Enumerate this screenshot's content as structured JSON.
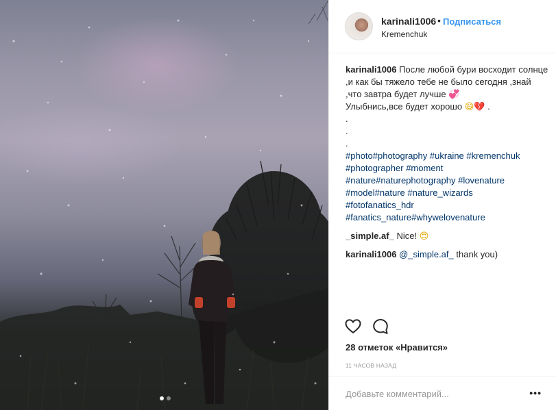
{
  "post": {
    "username": "karinali1006",
    "separator": "•",
    "follow_label": "Подписаться",
    "location": "Kremenchuk",
    "caption_user": "karinali1006",
    "caption_text": "После любой бури восходит солнце ,и как бы тяжело тебе не было сегодня ,знай ,что завтра будет лучше",
    "caption_emoji_1": "💞",
    "caption_line2": "Улыбнись,все будет хорошо",
    "caption_emoji_2": "😄💔",
    "caption_end": " .",
    "dots": [
      ".",
      ".",
      "."
    ],
    "hashtags": [
      "#photo",
      "#photography",
      "#ukraine",
      "#kremenchuk",
      "#photographer",
      "#moment",
      "#nature",
      "#naturephotography",
      "#lovenature",
      "#model",
      "#nature",
      "#nature_wizards",
      "#fotofanatics_hdr",
      "#fanatics_nature",
      "#whywelovenature"
    ],
    "comments": [
      {
        "user": "_simple.af_",
        "text": "Nice!",
        "emoji": "😍"
      },
      {
        "user": "karinali1006",
        "mention": "@_simple.af_",
        "text": "thank you)"
      }
    ],
    "likes_label": "28 отметок «Нравится»",
    "time_label": "11 часов назад",
    "comment_placeholder": "Добавьте комментарий...",
    "more_label": "•••",
    "carousel": {
      "count": 2,
      "active": 1
    }
  },
  "icons": {
    "like": "heart-outline-icon",
    "comment": "speech-bubble-icon",
    "more": "ellipsis-icon"
  },
  "colors": {
    "link": "#003569",
    "follow": "#3897f0",
    "text": "#262626",
    "muted": "#999999"
  }
}
